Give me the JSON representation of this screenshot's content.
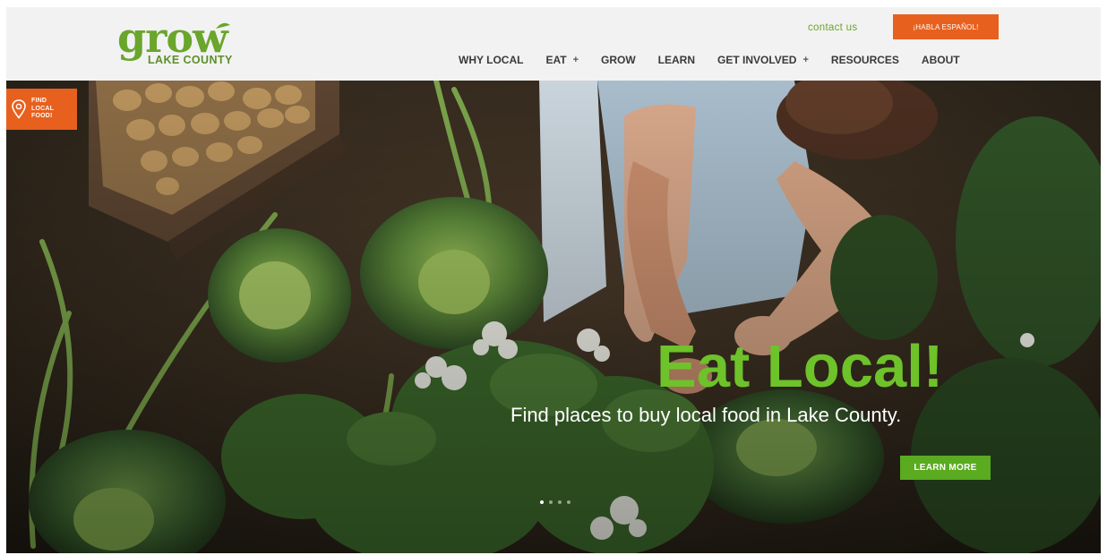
{
  "header": {
    "logo": {
      "wordmark": "grow",
      "subtitle": "LAKE COUNTY"
    },
    "contact_label": "contact us",
    "language_button": "¡HABLA ESPAÑOL!",
    "nav": [
      {
        "label": "WHY LOCAL",
        "has_submenu": false
      },
      {
        "label": "EAT",
        "has_submenu": true
      },
      {
        "label": "GROW",
        "has_submenu": false
      },
      {
        "label": "LEARN",
        "has_submenu": false
      },
      {
        "label": "GET INVOLVED",
        "has_submenu": true
      },
      {
        "label": "RESOURCES",
        "has_submenu": false
      },
      {
        "label": "ABOUT",
        "has_submenu": false
      }
    ],
    "submenu_marker": "+"
  },
  "hero": {
    "find_badge": "FIND\nLOCAL\nFOOD!",
    "headline": "Eat Local!",
    "subline": "Find places to buy local food in Lake County.",
    "cta_label": "LEARN MORE",
    "slides": {
      "count": 4,
      "active": 1
    }
  },
  "colors": {
    "brand_green": "#6ec22a",
    "accent_orange": "#e8601d",
    "nav_text": "#3a3a3a",
    "button_green": "#5aab20"
  }
}
